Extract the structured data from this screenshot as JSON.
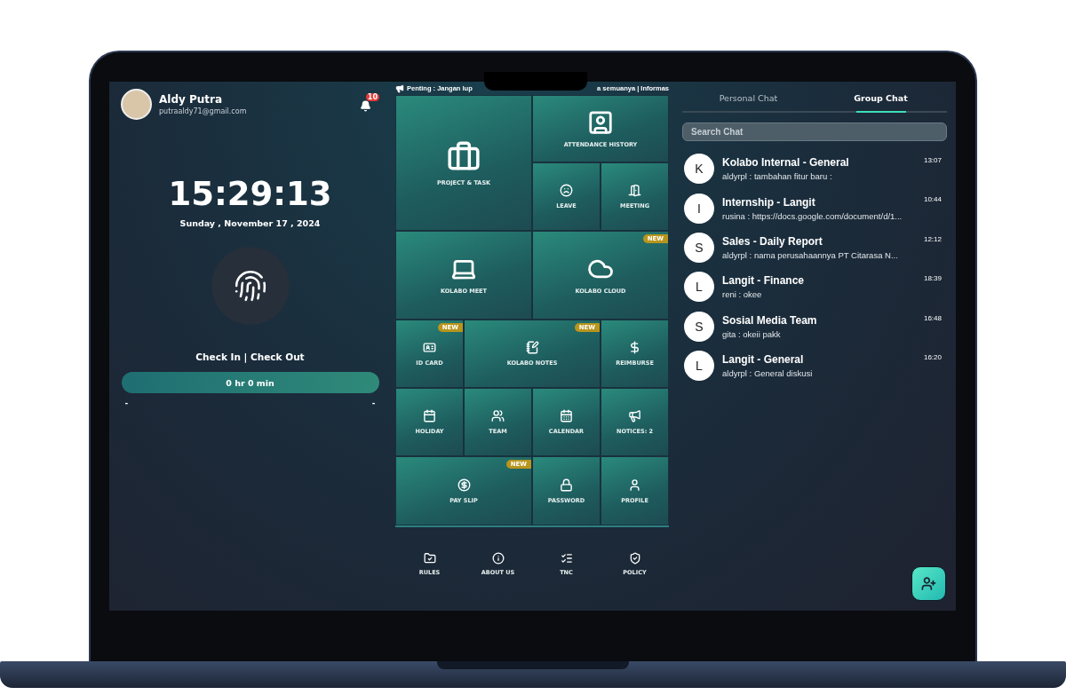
{
  "user": {
    "name": "Aldy Putra",
    "email": "putraaldy71@gmail.com",
    "notification_count": "10"
  },
  "clock": {
    "time": "15:29:13",
    "date": "Sunday , November 17 , 2024"
  },
  "attendance": {
    "label": "Check In | Check Out",
    "duration": "0 hr 0 min",
    "check_in": "-",
    "check_out": "-"
  },
  "ticker": {
    "before_notch": "Penting : Jangan lup",
    "after_notch": "a semuanya | Informas"
  },
  "tiles": [
    {
      "label": "PROJECT & TASK",
      "kind": "large"
    },
    {
      "label": "ATTENDANCE HISTORY",
      "kind": "wide"
    },
    {
      "label": "LEAVE",
      "kind": "small"
    },
    {
      "label": "MEETING",
      "kind": "small"
    },
    {
      "label": "KOLABO MEET",
      "kind": "wide"
    },
    {
      "label": "KOLABO CLOUD",
      "kind": "wide",
      "badge": "NEW"
    },
    {
      "label": "ID CARD",
      "kind": "small",
      "badge": "NEW"
    },
    {
      "label": "KOLABO NOTES",
      "kind": "wide",
      "badge": "NEW"
    },
    {
      "label": "REIMBURSE",
      "kind": "small"
    },
    {
      "label": "HOLIDAY",
      "kind": "small"
    },
    {
      "label": "TEAM",
      "kind": "small"
    },
    {
      "label": "CALENDAR",
      "kind": "small"
    },
    {
      "label": "NOTICES: 2",
      "kind": "small"
    },
    {
      "label": "PAY SLIP",
      "kind": "wide",
      "badge": "NEW"
    },
    {
      "label": "PASSWORD",
      "kind": "small"
    },
    {
      "label": "PROFILE",
      "kind": "small"
    }
  ],
  "footer_links": [
    "RULES",
    "ABOUT US",
    "TNC",
    "POLICY"
  ],
  "chat_tabs": [
    {
      "label": "Personal Chat",
      "selected": false
    },
    {
      "label": "Group Chat",
      "selected": true
    }
  ],
  "search": {
    "placeholder": "Search Chat"
  },
  "chats": [
    {
      "initial": "K",
      "name": "Kolabo Internal - General",
      "message": "aldyrpl : tambahan fitur baru :",
      "time": "13:07"
    },
    {
      "initial": "I",
      "name": "Internship - Langit",
      "message": "rusina : https://docs.google.com/document/d/1...",
      "time": "10:44"
    },
    {
      "initial": "S",
      "name": "Sales - Daily Report",
      "message": "aldyrpl : nama perusahaannya PT Citarasa N...",
      "time": "12:12"
    },
    {
      "initial": "L",
      "name": "Langit - Finance",
      "message": "reni : okee",
      "time": "18:39"
    },
    {
      "initial": "S",
      "name": "Sosial Media Team",
      "message": "gita : okeii pakk",
      "time": "16:48"
    },
    {
      "initial": "L",
      "name": "Langit - General",
      "message": "aldyrpl : General diskusi",
      "time": "16:20"
    }
  ]
}
